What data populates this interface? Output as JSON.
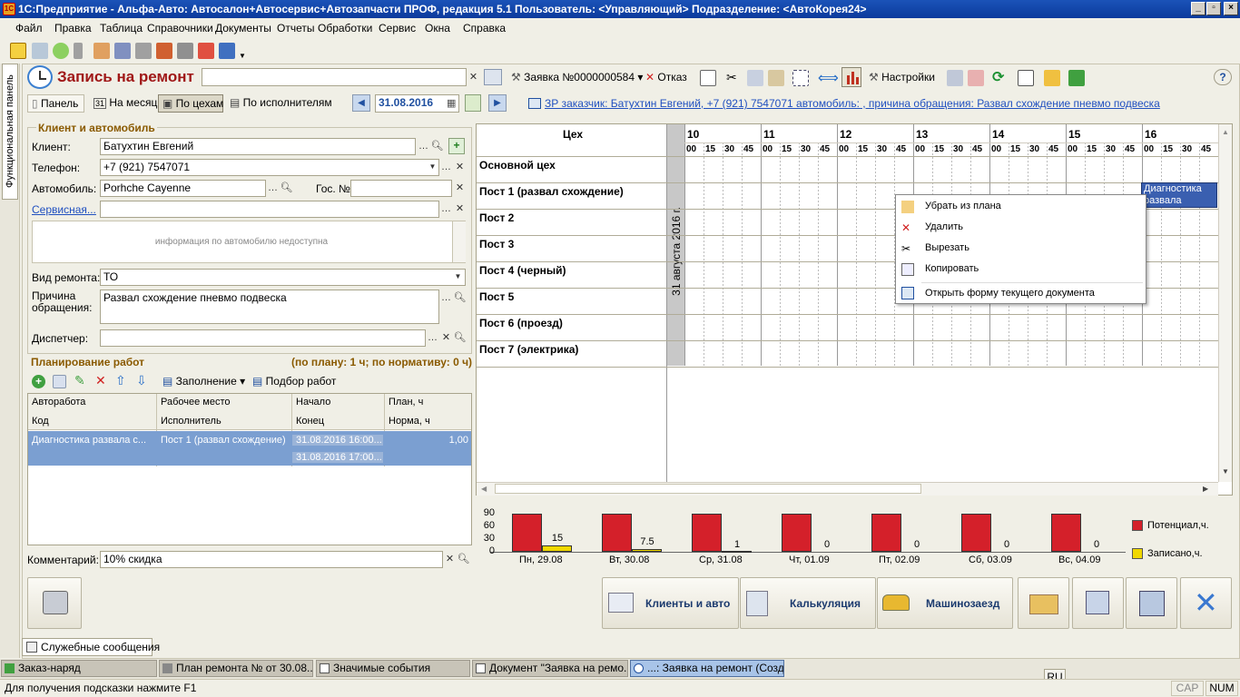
{
  "window": {
    "title": "1С:Предприятие - Альфа-Авто: Автосалон+Автосервис+Автозапчасти ПРОФ, редакция 5.1    Пользователь: <Управляющий>    Подразделение: <АвтоКорея24>"
  },
  "menu": [
    "Файл",
    "Правка",
    "Таблица",
    "Справочники",
    "Документы",
    "Отчеты",
    "Обработки",
    "Сервис",
    "Окна",
    "Справка"
  ],
  "left_panel": {
    "label": "Функциональная панель"
  },
  "form": {
    "title": "Запись на ремонт",
    "order_label": "Заявка №0000000584",
    "cancel_label": "Отказ",
    "settings_label": "Настройки",
    "date": "31.08.2016",
    "tabs": {
      "panel": "Панель",
      "month": "На месяц",
      "shops": "По цехам",
      "executors": "По исполнителям"
    },
    "info_link": "ЗР заказчик: Батухтин Евгений, +7 (921) 7547071 автомобиль: , причина обращения: Развал схождение пневмо подвеска"
  },
  "client": {
    "group_title": "Клиент и автомобиль",
    "client_label": "Клиент:",
    "client_value": "Батухтин Евгений",
    "phone_label": "Телефон:",
    "phone_value": "+7 (921) 7547071",
    "car_label": "Автомобиль:",
    "car_value": "Porhche Cayenne",
    "gos_label": "Гос. №",
    "service_label": "Сервисная...",
    "car_info": "информация по автомобилю недоступна",
    "repair_label": "Вид ремонта:",
    "repair_value": "ТО",
    "reason_label1": "Причина",
    "reason_label2": "обращения:",
    "reason_value": "Развал схождение пневмо подвеска",
    "dispatcher_label": "Диспетчер:"
  },
  "planning": {
    "title": "Планирование работ",
    "summary": "(по плану: 1 ч; по нормативу: 0 ч)",
    "fill_label": "Заполнение",
    "select_label": "Подбор работ",
    "columns": {
      "c1a": "Авторабота",
      "c1b": "Код",
      "c2a": "Рабочее место",
      "c2b": "Исполнитель",
      "c3a": "Начало",
      "c3b": "Конец",
      "c4a": "План, ч",
      "c4b": "Норма, ч"
    },
    "rows": [
      {
        "work": "Диагностика развала с...",
        "place": "Пост 1 (развал схождение)",
        "start": "31.08.2016 16:00...",
        "end": "31.08.2016 17:00...",
        "plan": "1,00"
      }
    ]
  },
  "comment": {
    "label": "Комментарий:",
    "value": "10% скидка"
  },
  "schedule": {
    "header": "Цех",
    "date_vertical": "31 августа 2016 г.",
    "hours": [
      "10",
      "11",
      "12",
      "13",
      "14",
      "15",
      "16"
    ],
    "minutes": [
      "00",
      "15",
      "30",
      "45"
    ],
    "posts": [
      "Основной цех",
      "Пост 1 (развал схождение)",
      "Пост 2",
      "Пост 3",
      "Пост 4 (черный)",
      "Пост 5",
      "Пост 6 (проезд)",
      "Пост 7 (электрика)"
    ],
    "event": "Диагностика развала"
  },
  "context_menu": [
    "Убрать из плана",
    "Удалить",
    "Вырезать",
    "Копировать",
    "Открыть форму текущего документа"
  ],
  "chart_data": {
    "type": "bar",
    "categories": [
      "Пн, 29.08",
      "Вт, 30.08",
      "Ср, 31.08",
      "Чт, 01.09",
      "Пт, 02.09",
      "Сб, 03.09",
      "Вс, 04.09"
    ],
    "series": [
      {
        "name": "Потенциал,ч.",
        "color": "#d4202a",
        "values": [
          90,
          90,
          90,
          90,
          90,
          90,
          90
        ]
      },
      {
        "name": "Записано,ч.",
        "color": "#f0d800",
        "values": [
          15,
          7.5,
          1,
          0,
          0,
          0,
          0
        ]
      }
    ],
    "yticks": [
      "90",
      "60",
      "30",
      "0"
    ],
    "ylim": [
      0,
      90
    ],
    "labels": [
      "15",
      "7.5",
      "1",
      "0",
      "0",
      "0",
      "0"
    ],
    "legend": "right"
  },
  "bottom_buttons": {
    "clients": "Клиенты и авто",
    "calc": "Калькуляция",
    "carentry": "Машинозаезд"
  },
  "service_messages": "Служебные сообщения",
  "taskbar": [
    "Заказ-наряд",
    "План ремонта №  от 30.08....",
    "Значимые события",
    "Документ \"Заявка на ремо...",
    "...: Заявка на ремонт (Созд..."
  ],
  "status": {
    "hint": "Для получения подсказки нажмите F1",
    "lang": "RU",
    "cap": "CAP",
    "num": "NUM"
  }
}
